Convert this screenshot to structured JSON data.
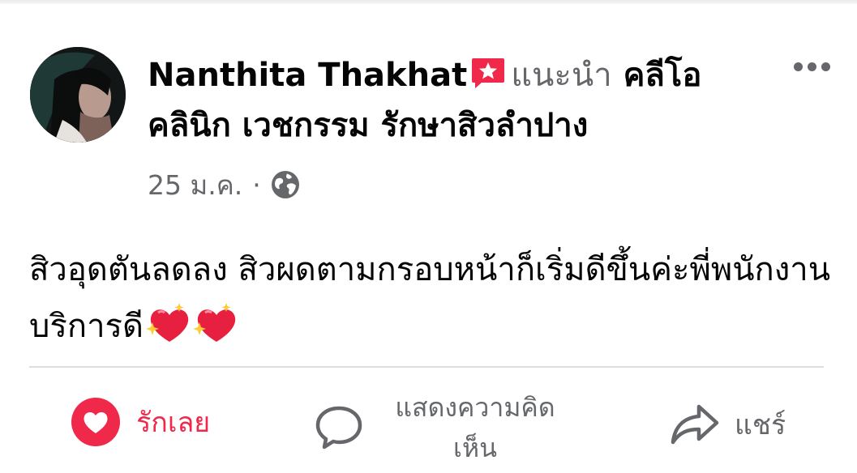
{
  "post": {
    "author_name": "Nanthita Thakhat",
    "recommends_word": "แนะนำ",
    "page_name": "คลีโอ คลินิก เวชกรรม รักษาสิวลำปาง",
    "date": "25 ม.ค.",
    "separator": "·",
    "privacy_icon": "globe-icon",
    "body_text": "สิวอุดตันลดลง สิวผดตามกรอบหน้าก็เริ่มดีขึ้นค่ะพี่พนักงานบริการดี",
    "body_emojis": [
      "sparkling-heart",
      "sparkling-heart"
    ]
  },
  "actions": {
    "like_label": "รักเลย",
    "comment_label": "แสดงความคิดเห็น",
    "share_label": "แชร์"
  },
  "colors": {
    "love": "#f0284a",
    "secondary_text": "#65676b",
    "primary_text": "#050505",
    "divider": "#dadde1"
  }
}
